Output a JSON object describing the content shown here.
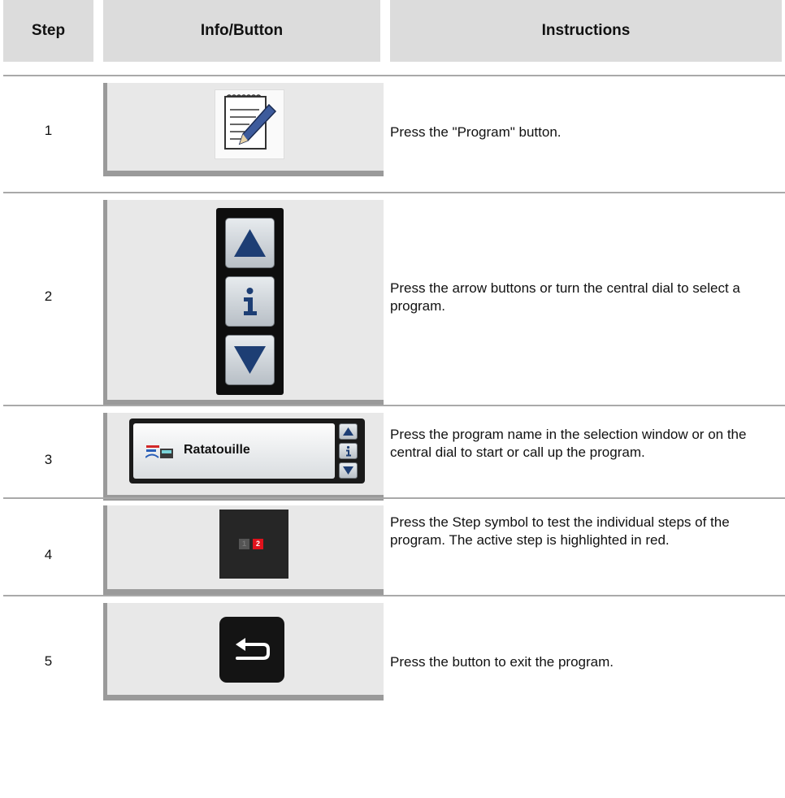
{
  "header": {
    "step": "Step",
    "info": "Info/Button",
    "instructions": "Instructions"
  },
  "rows": [
    {
      "num": "1",
      "instruction": "Press the \"Program\" button.",
      "icon": "program-edit-icon"
    },
    {
      "num": "2",
      "instruction": "Press the arrow buttons or turn the central dial to select a program.",
      "icon": "arrow-buttons"
    },
    {
      "num": "3",
      "instruction": "Press the program name in the selection window or on the central dial to start or call up the program.",
      "icon": "program-selection-window",
      "program_name": "Ratatouille"
    },
    {
      "num": "4",
      "instruction": "Press the Step symbol to test the individual steps of the program. The active step is highlighted in red.",
      "icon": "step-symbol-icon",
      "step_inactive": "1",
      "step_active": "2"
    },
    {
      "num": "5",
      "instruction": "Press the button to exit the program.",
      "icon": "back-exit-icon"
    }
  ],
  "colors": {
    "header_bg": "#dcdcdc",
    "panel_bg": "#e8e8e8",
    "active_step": "#e0121c",
    "arrow_blue": "#1d3e74"
  }
}
